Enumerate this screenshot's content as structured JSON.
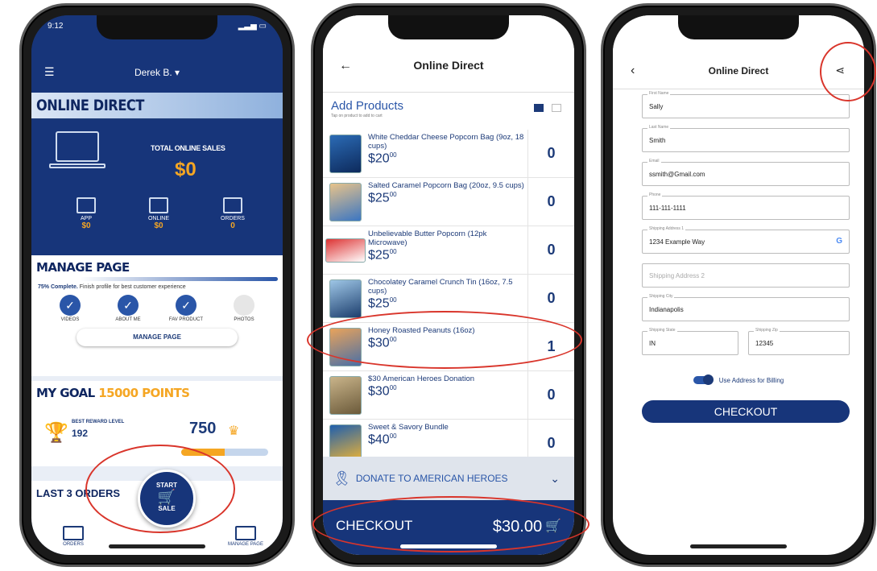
{
  "phone1": {
    "status_time": "9:12",
    "user_name": "Derek B. ▾",
    "banner_title": "ONLINE DIRECT",
    "total_label": "TOTAL ONLINE SALES",
    "total_value": "$0",
    "stats": [
      {
        "label": "APP",
        "value": "$0"
      },
      {
        "label": "ONLINE",
        "value": "$0"
      },
      {
        "label": "ORDERS",
        "value": "0"
      }
    ],
    "manage_title": "MANAGE PAGE",
    "manage_percent": "75% Complete.",
    "manage_text": "Finish profile for best customer experience",
    "checks": [
      {
        "label": "VIDEOS",
        "done": true
      },
      {
        "label": "ABOUT ME",
        "done": true
      },
      {
        "label": "FAV PRODUCT",
        "done": true
      },
      {
        "label": "PHOTOS",
        "done": false
      }
    ],
    "manage_button": "MANAGE PAGE",
    "goal_title": "MY GOAL",
    "goal_points": "15000 POINTS",
    "best_label": "BEST REWARD LEVEL",
    "best_value": "192",
    "current_points": "750",
    "progress_fraction": 0.5,
    "last_title": "LAST 3 ORDERS",
    "tab_orders": "ORDERS",
    "tab_manage": "MANAGE PAGE",
    "start_label": "START",
    "sale_label": "SALE"
  },
  "phone2": {
    "title": "Online Direct",
    "add_products": "Add Products",
    "add_sub": "Tap on product to add to cart",
    "products": [
      {
        "name": "White Cheddar Cheese Popcorn Bag (9oz, 18 cups)",
        "price": "$20",
        "cents": "00",
        "qty": "0"
      },
      {
        "name": "Salted Caramel Popcorn Bag (20oz, 9.5 cups)",
        "price": "$25",
        "cents": "00",
        "qty": "0"
      },
      {
        "name": "Unbelievable Butter Popcorn (12pk Microwave)",
        "price": "$25",
        "cents": "00",
        "qty": "0"
      },
      {
        "name": "Chocolatey Caramel Crunch Tin (16oz, 7.5 cups)",
        "price": "$25",
        "cents": "00",
        "qty": "0"
      },
      {
        "name": "Honey Roasted Peanuts (16oz)",
        "price": "$30",
        "cents": "00",
        "qty": "1"
      },
      {
        "name": "$30 American Heroes Donation",
        "price": "$30",
        "cents": "00",
        "qty": "0"
      },
      {
        "name": "Sweet & Savory Bundle",
        "price": "$40",
        "cents": "00",
        "qty": "0"
      }
    ],
    "donate_label": "DONATE TO AMERICAN HEROES",
    "checkout_label": "CHECKOUT",
    "checkout_amount": "$30.00"
  },
  "phone3": {
    "title": "Online Direct",
    "fields": [
      {
        "label": "First Name",
        "value": "Sally"
      },
      {
        "label": "Last Name",
        "value": "Smith"
      },
      {
        "label": "Email",
        "value": "ssmith@Gmail.com"
      },
      {
        "label": "Phone",
        "value": "111-111-1111"
      },
      {
        "label": "Shipping Address 1",
        "value": "1234 Example Way"
      },
      {
        "label": "",
        "value": "Shipping Address 2"
      },
      {
        "label": "Shipping City",
        "value": "Indianapolis"
      },
      {
        "label": "Shipping State",
        "value": "IN"
      },
      {
        "label": "Shipping Zip",
        "value": "12345"
      }
    ],
    "billing_toggle": "Use Address for Billing",
    "checkout_button": "CHECKOUT"
  },
  "colors": {
    "brand_navy": "#17357a",
    "accent_orange": "#f5a623",
    "annotation_red": "#d9352b"
  }
}
